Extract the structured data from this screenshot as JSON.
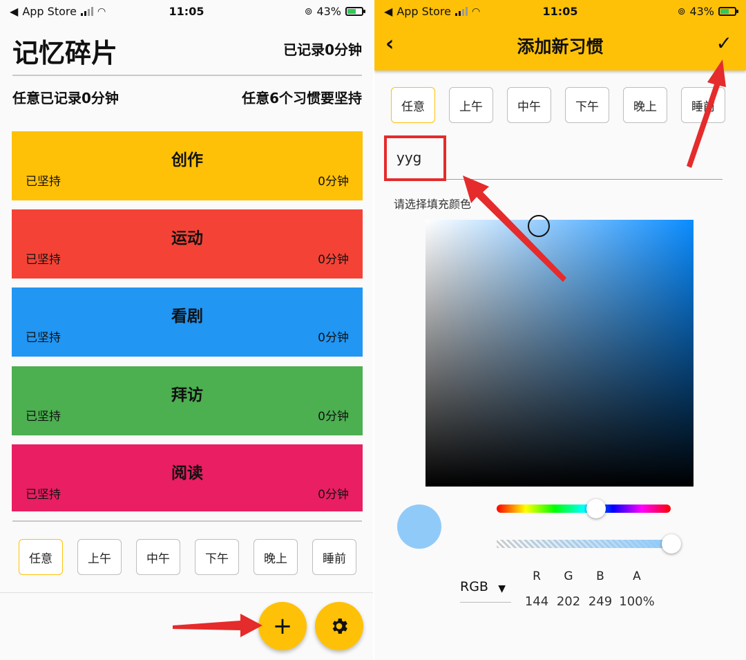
{
  "left": {
    "status": {
      "carrier": "App Store",
      "time": "11:05",
      "battery": "43%"
    },
    "title": "记忆碎片",
    "recorded": "已记录0分钟",
    "summary_left": "任意已记录0分钟",
    "summary_right": "任意6个习惯要坚持",
    "habits": [
      {
        "name": "创作",
        "keep": "已坚持",
        "minutes": "0分钟",
        "color": "#ffc107"
      },
      {
        "name": "运动",
        "keep": "已坚持",
        "minutes": "0分钟",
        "color": "#f44336"
      },
      {
        "name": "看剧",
        "keep": "已坚持",
        "minutes": "0分钟",
        "color": "#2196f3"
      },
      {
        "name": "拜访",
        "keep": "已坚持",
        "minutes": "0分钟",
        "color": "#4caf50"
      },
      {
        "name": "阅读",
        "keep": "已坚持",
        "minutes": "0分钟",
        "color": "#e91e63"
      }
    ],
    "time_chips": [
      "任意",
      "上午",
      "中午",
      "下午",
      "晚上",
      "睡前"
    ],
    "selected_chip": "任意",
    "fab_add": "+",
    "fab_settings_icon": "gear-icon"
  },
  "right": {
    "status": {
      "carrier": "App Store",
      "time": "11:05",
      "battery": "43%"
    },
    "header_title": "添加新习惯",
    "back_icon": "back-arrow-icon",
    "confirm_icon": "check-icon",
    "time_chips": [
      "任意",
      "上午",
      "中午",
      "下午",
      "晚上",
      "睡前"
    ],
    "selected_chip": "任意",
    "habit_name_value": "yyg",
    "fill_color_label": "请选择填充颜色",
    "picker": {
      "mode": "RGB",
      "labels": [
        "R",
        "G",
        "B",
        "A"
      ],
      "values": [
        "144",
        "202",
        "249",
        "100%"
      ],
      "selected_color": "#90caf9"
    }
  },
  "accent_color": "#ffc107"
}
